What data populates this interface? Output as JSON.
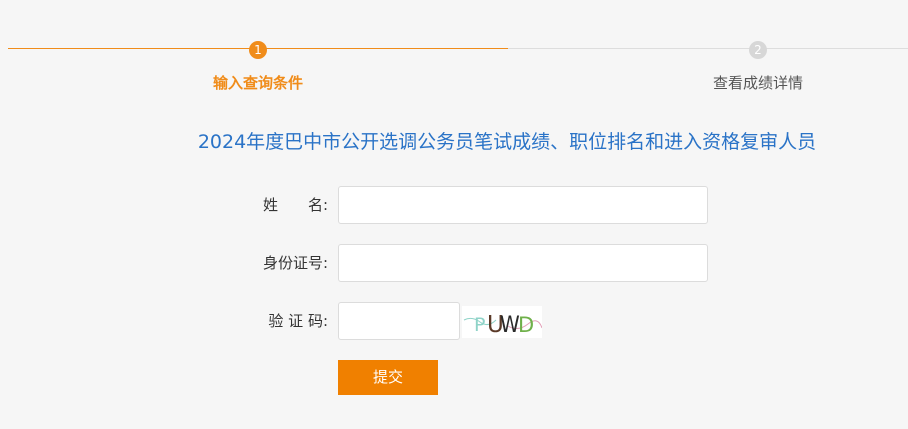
{
  "steps": [
    {
      "number": "1",
      "label": "输入查询条件",
      "state": "active"
    },
    {
      "number": "2",
      "label": "查看成绩详情",
      "state": "inactive"
    }
  ],
  "title": "2024年度巴中市公开选调公务员笔试成绩、职位排名和进入资格复审人员",
  "form": {
    "name_label": "姓　　名:",
    "name_value": "",
    "id_label": "身份证号:",
    "id_value": "",
    "captcha_label": "验 证 码:",
    "captcha_value": "",
    "captcha_text": "PUWD",
    "submit_label": "提交"
  },
  "colors": {
    "accent": "#f08c1a",
    "title": "#2a73c7",
    "inactive": "#d7d7d7",
    "background": "#f6f6f6"
  }
}
